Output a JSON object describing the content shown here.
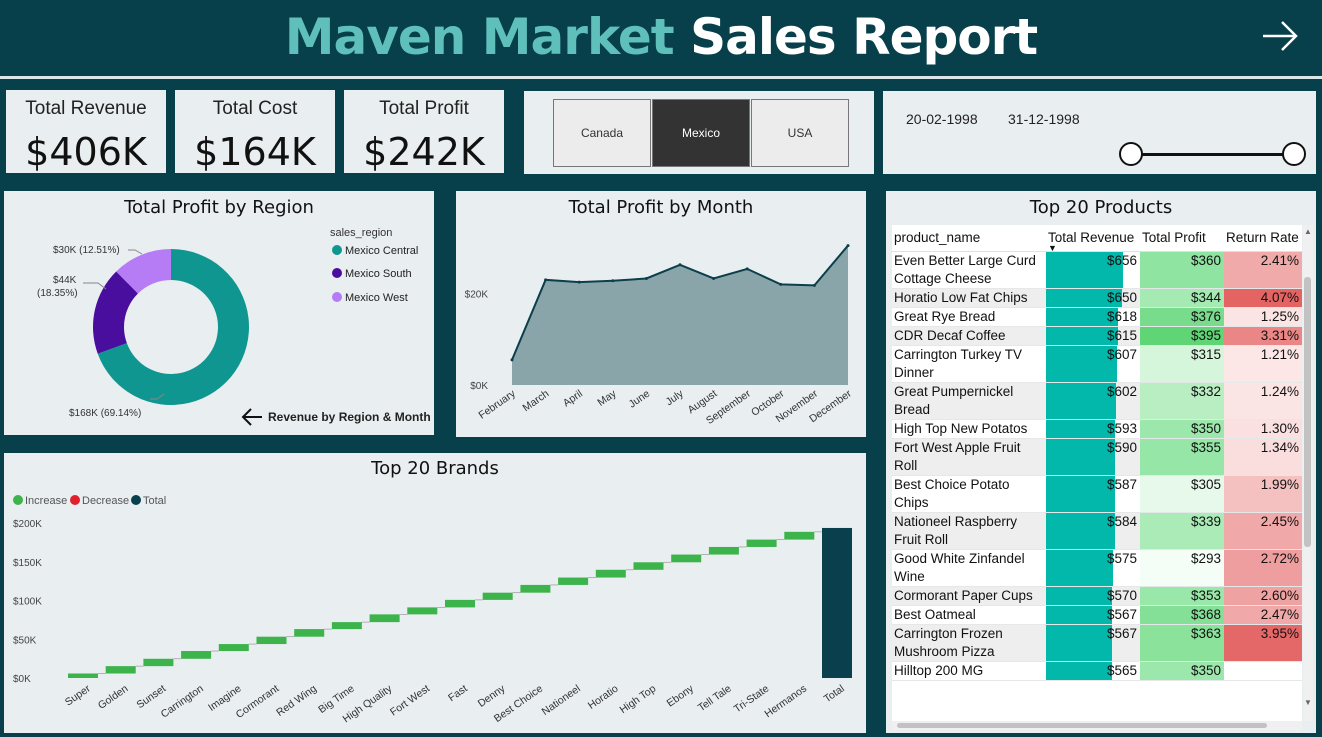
{
  "header": {
    "title_part1": "Maven Market",
    "title_part2": "Sales Report",
    "next_icon": "arrow-right-icon"
  },
  "kpis": [
    {
      "label": "Total Revenue",
      "value": "$406K"
    },
    {
      "label": "Total Cost",
      "value": "$164K"
    },
    {
      "label": "Total Profit",
      "value": "$242K"
    }
  ],
  "country_slicer": {
    "options": [
      "Canada",
      "Mexico",
      "USA"
    ],
    "selected": "Mexico"
  },
  "date_slicer": {
    "start": "20-02-1998",
    "end": "31-12-1998"
  },
  "colors": {
    "background": "#073f4b",
    "panel": "#e9eef0",
    "accent_teal": "#5fc0bb",
    "mexico_central": "#0f9690",
    "mexico_south": "#4a0e9e",
    "mexico_west": "#b57cf5",
    "increase": "#3cb34b",
    "decrease": "#e0202c",
    "total": "#0a3f4d",
    "area": "#8aa5a9"
  },
  "region_chart": {
    "title": "Total Profit by Region",
    "legend_title": "sales_region",
    "link_text": "Revenue by Region & Month",
    "labels": {
      "central": "$168K (69.14%)",
      "south_line1": "$44K",
      "south_line2": "(18.35%)",
      "west": "$30K (12.51%)"
    },
    "chart_data": {
      "type": "pie",
      "categories": [
        "Mexico Central",
        "Mexico South",
        "Mexico West"
      ],
      "values": [
        168,
        44,
        30
      ],
      "percents": [
        69.14,
        18.35,
        12.51
      ],
      "title": "Total Profit by Region"
    }
  },
  "month_chart": {
    "title": "Total Profit by Month",
    "chart_data": {
      "type": "area",
      "title": "Total Profit by Month",
      "categories": [
        "February",
        "March",
        "April",
        "May",
        "June",
        "July",
        "August",
        "September",
        "October",
        "November",
        "December"
      ],
      "values": [
        5500,
        23000,
        22500,
        22800,
        23300,
        26300,
        23300,
        25400,
        22000,
        21800,
        30500
      ],
      "ylim": [
        0,
        35000
      ],
      "yticks": [
        "$0K",
        "$20K"
      ]
    }
  },
  "brands_chart": {
    "title": "Top 20 Brands",
    "legend": [
      "Increase",
      "Decrease",
      "Total"
    ],
    "chart_data": {
      "type": "waterfall",
      "title": "Top 20 Brands",
      "categories": [
        "Super",
        "Golden",
        "Sunset",
        "Carrington",
        "Imagine",
        "Cormorant",
        "Red Wing",
        "Big Time",
        "High Quality",
        "Fort West",
        "Fast",
        "Denny",
        "Best Choice",
        "Nationeel",
        "Horatio",
        "High Top",
        "Ebony",
        "Tell Tale",
        "Tri-State",
        "Hermanos",
        "Total"
      ],
      "increments": [
        5800,
        9500,
        9500,
        10000,
        9000,
        9500,
        9800,
        9000,
        10000,
        9000,
        9700,
        9300,
        10000,
        9500,
        10000,
        9700,
        10000,
        9800,
        9500,
        10000
      ],
      "total": 193600,
      "ylim": [
        0,
        200000
      ],
      "yticks": [
        "$0K",
        "$50K",
        "$100K",
        "$150K",
        "$200K"
      ]
    }
  },
  "products_table": {
    "title": "Top 20 Products",
    "columns": [
      "product_name",
      "Total Revenue",
      "Total Profit",
      "Return Rate"
    ],
    "rows": [
      {
        "name": "Even Better Large Curd Cottage Cheese",
        "revenue": "$656",
        "profit": "$360",
        "rate": "2.41%",
        "rev_frac": 1.0,
        "profit_bg": "#8ee4a0",
        "rate_bg": "#f0aaaa"
      },
      {
        "name": "Horatio Low Fat Chips",
        "revenue": "$650",
        "profit": "$344",
        "rate": "4.07%",
        "rev_frac": 0.99,
        "profit_bg": "#a4eab2",
        "rate_bg": "#e46464"
      },
      {
        "name": "Great Rye Bread",
        "revenue": "$618",
        "profit": "$376",
        "rate": "1.25%",
        "rev_frac": 0.94,
        "profit_bg": "#79dc8d",
        "rate_bg": "#fbe4e4"
      },
      {
        "name": "CDR Decaf Coffee",
        "revenue": "$615",
        "profit": "$395",
        "rate": "3.31%",
        "rev_frac": 0.94,
        "profit_bg": "#5fd575",
        "rate_bg": "#ea8686"
      },
      {
        "name": "Carrington Turkey TV Dinner",
        "revenue": "$607",
        "profit": "$315",
        "rate": "1.21%",
        "rev_frac": 0.92,
        "profit_bg": "#d6f6dc",
        "rate_bg": "#fce6e6"
      },
      {
        "name": "Great Pumpernickel Bread",
        "revenue": "$602",
        "profit": "$332",
        "rate": "1.24%",
        "rev_frac": 0.91,
        "profit_bg": "#b9eec3",
        "rate_bg": "#fbe4e4"
      },
      {
        "name": "High Top New Potatos",
        "revenue": "$593",
        "profit": "$350",
        "rate": "1.30%",
        "rev_frac": 0.9,
        "profit_bg": "#9ce8ac",
        "rate_bg": "#fae0e0"
      },
      {
        "name": "Fort West Apple Fruit Roll",
        "revenue": "$590",
        "profit": "$355",
        "rate": "1.34%",
        "rev_frac": 0.9,
        "profit_bg": "#96e6a7",
        "rate_bg": "#fadede"
      },
      {
        "name": "Best Choice Potato Chips",
        "revenue": "$587",
        "profit": "$305",
        "rate": "1.99%",
        "rev_frac": 0.89,
        "profit_bg": "#e6f9ea",
        "rate_bg": "#f4c0c0"
      },
      {
        "name": "Nationeel Raspberry Fruit Roll",
        "revenue": "$584",
        "profit": "$339",
        "rate": "2.45%",
        "rev_frac": 0.89,
        "profit_bg": "#abebb8",
        "rate_bg": "#f0a8a8"
      },
      {
        "name": "Good White Zinfandel Wine",
        "revenue": "$575",
        "profit": "$293",
        "rate": "2.72%",
        "rev_frac": 0.87,
        "profit_bg": "#f5fdf7",
        "rate_bg": "#ee9e9e"
      },
      {
        "name": "Cormorant Paper Cups",
        "revenue": "$570",
        "profit": "$353",
        "rate": "2.60%",
        "rev_frac": 0.86,
        "profit_bg": "#99e7a9",
        "rate_bg": "#efa2a2"
      },
      {
        "name": "Best Oatmeal",
        "revenue": "$567",
        "profit": "$368",
        "rate": "2.47%",
        "rev_frac": 0.86,
        "profit_bg": "#84e096",
        "rate_bg": "#f0a8a8"
      },
      {
        "name": "Carrington Frozen Mushroom Pizza",
        "revenue": "$567",
        "profit": "$363",
        "rate": "3.95%",
        "rev_frac": 0.86,
        "profit_bg": "#8ae29b",
        "rate_bg": "#e56868"
      },
      {
        "name": "Hilltop 200 MG",
        "revenue": "$565",
        "profit": "$350",
        "rate": "",
        "rev_frac": 0.86,
        "profit_bg": "#9ce8ac",
        "rate_bg": "#ffffff"
      }
    ]
  }
}
